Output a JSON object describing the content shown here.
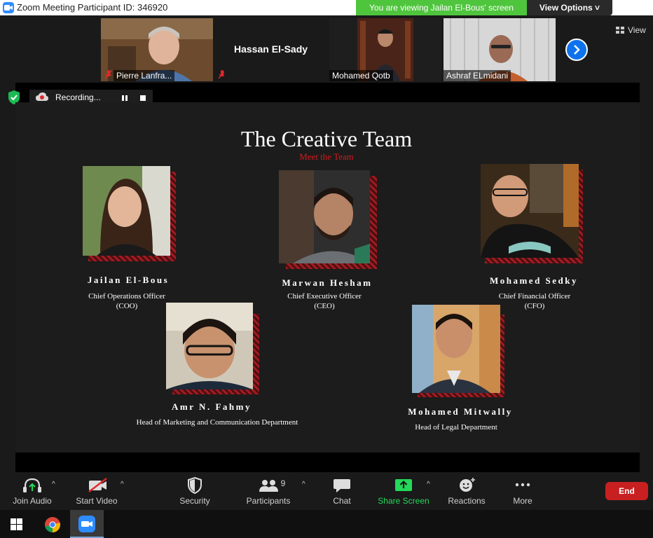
{
  "window": {
    "title": "Zoom Meeting Participant ID: 346920",
    "banner": "You are viewing Jailan El-Bous' screen",
    "view_options": "View Options ˅"
  },
  "gallery": {
    "participants": [
      {
        "name": "Pierre Lanfra...",
        "muted": true
      },
      {
        "name": "Hassan El-Sady",
        "muted": true
      },
      {
        "name": "Mohamed Qotb",
        "muted": false
      },
      {
        "name": "Ashraf ELmidani",
        "muted": false
      }
    ],
    "view_label": "View"
  },
  "recording": {
    "label": "Recording..."
  },
  "slide": {
    "title": "The Creative Team",
    "subtitle": "Meet the Team",
    "members": [
      {
        "name": "Jailan El-Bous",
        "role_line1": "Chief Operations Officer",
        "role_line2": "(COO)"
      },
      {
        "name": "Marwan Hesham",
        "role_line1": "Chief Executive Officer",
        "role_line2": "(CEO)"
      },
      {
        "name": "Mohamed Sedky",
        "role_line1": "Chief Financial Officer",
        "role_line2": "(CFO)"
      },
      {
        "name": "Amr N. Fahmy",
        "role_line1": "Head of Marketing and Communication Department",
        "role_line2": ""
      },
      {
        "name": "Mohamed Mitwally",
        "role_line1": "Head of Legal Department",
        "role_line2": ""
      }
    ]
  },
  "toolbar": {
    "join_audio": "Join Audio",
    "start_video": "Start Video",
    "security": "Security",
    "participants": "Participants",
    "participants_count": "9",
    "chat": "Chat",
    "share_screen": "Share Screen",
    "reactions": "Reactions",
    "more": "More",
    "end": "End"
  },
  "colors": {
    "zoom_blue": "#2d8cff",
    "banner_green": "#4fc53e",
    "share_green": "#23d959",
    "end_red": "#c82020",
    "slide_accent_red": "#d01b1b"
  }
}
